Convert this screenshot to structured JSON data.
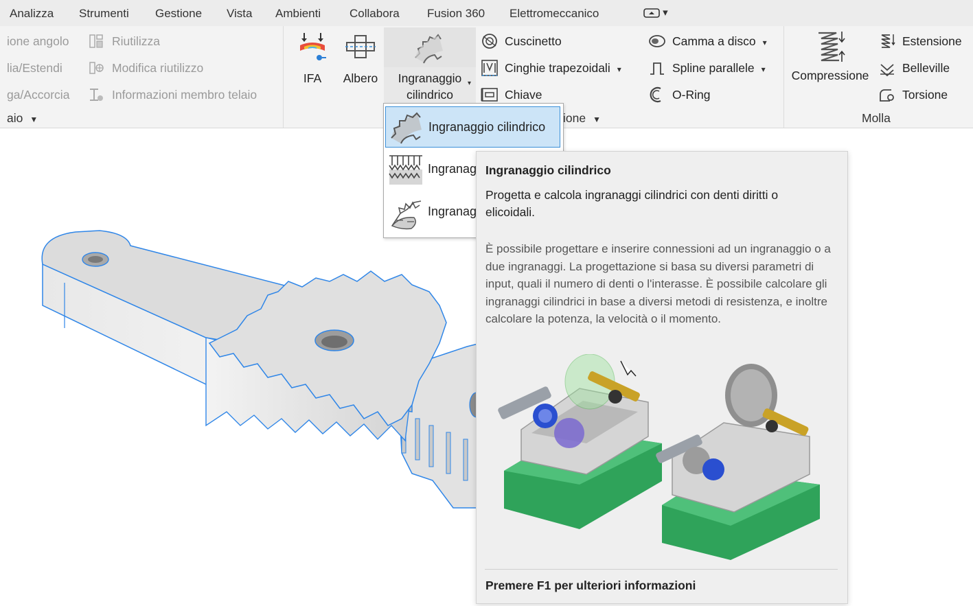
{
  "tabs": {
    "items": [
      "Analizza",
      "Strumenti",
      "Gestione",
      "Vista",
      "Ambienti",
      "Collabora",
      "Fusion 360",
      "Elettromeccanico"
    ],
    "more_caret": "▾"
  },
  "ribbon": {
    "frame": {
      "items": [
        "ione angolo",
        "lia/Estendi",
        "ga/Accorcia"
      ],
      "tools": [
        "Riutilizza",
        "Modifica riutilizzo",
        "Informazioni membro telaio"
      ],
      "panel_label": "aio"
    },
    "design": {
      "ifa": "IFA",
      "albero": "Albero",
      "gear_line1": "Ingranaggio",
      "gear_line2": "cilindrico",
      "col1": [
        "Cuscinetto",
        "Cinghie trapezoidali",
        "Chiave"
      ],
      "col2": [
        "Camma a disco",
        "Spline parallele",
        "O-Ring"
      ],
      "panel_label": "ione"
    },
    "spring": {
      "compressione": "Compressione",
      "items": [
        "Estensione",
        "Belleville",
        "Torsione"
      ],
      "panel_label": "Molla"
    }
  },
  "dropdown": {
    "items": [
      "Ingranaggio cilindrico",
      "Ingranag",
      "Ingranag"
    ],
    "selected_index": 0
  },
  "tooltip": {
    "title": "Ingranaggio cilindrico",
    "description": "Progetta e calcola ingranaggi cilindrici con denti diritti o elicoidali.",
    "details": "È possibile progettare e inserire connessioni ad un ingranaggio o a due ingranaggi. La progettazione si basa su diversi parametri di input, quali il numero di denti o l'interasse. È possibile calcolare gli ingranaggi cilindrici in base a diversi metodi di resistenza, e inoltre calcolare la potenza, la velocità o il momento.",
    "footer": "Premere F1 per ulteriori informazioni"
  },
  "colors": {
    "selection_blue": "#2f86e8",
    "dropdown_highlight": "#cce4f7",
    "gearbox_green": "#2fa35a",
    "shaft_gold": "#c9a227",
    "bearing_blue": "#2a4fd0"
  }
}
